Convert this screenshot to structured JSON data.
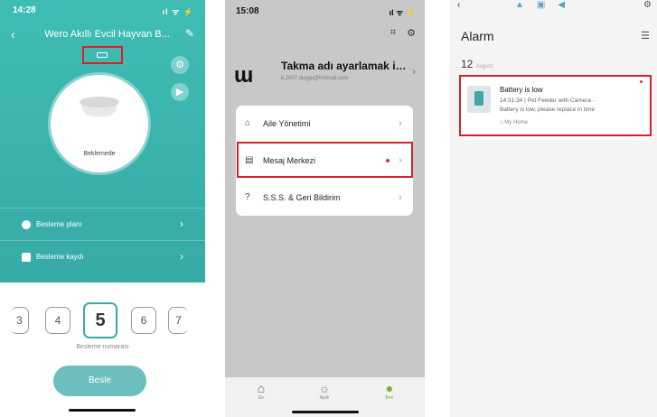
{
  "screen1": {
    "time": "14:28",
    "signal": "ıl ᯤ ⚡",
    "title": "Wero Akıllı Evcil Hayvan B...",
    "status_label": "Beklemede",
    "rows": [
      {
        "label": "Besleme planı"
      },
      {
        "label": "Besleme kaydı"
      }
    ],
    "numbers": [
      "3",
      "4",
      "5",
      "6",
      "7"
    ],
    "selected_number": "5",
    "picker_label": "Besleme numarası",
    "feed_button": "Besle",
    "accent_color": "#3fbdb5"
  },
  "screen2": {
    "time": "15:08",
    "signal": "ıl ᯤ ⚡",
    "logo": "ɯ",
    "username": "Takma adı ayarlamak iç...",
    "email": "k.2007.duygu@hotmail.com",
    "menu": [
      {
        "label": "Aile Yönetimi",
        "icon": "home-outline-icon"
      },
      {
        "label": "Mesaj Merkezi",
        "icon": "message-icon"
      },
      {
        "label": "S.S.S. & Geri Bildirim",
        "icon": "help-icon"
      }
    ],
    "tabs": [
      {
        "label": "Ev",
        "icon": "home-icon"
      },
      {
        "label": "Akıllı",
        "icon": "sun-icon"
      },
      {
        "label": "Ben",
        "icon": "person-icon"
      }
    ]
  },
  "screen3": {
    "title": "Alarm",
    "date_day": "12",
    "date_month": "August",
    "alarm": {
      "title": "Battery is low",
      "line1": "14:31:34 | Pet Feeder with Camera  -",
      "line2": "Battery is low, please replace in time",
      "home": "My Home"
    }
  }
}
